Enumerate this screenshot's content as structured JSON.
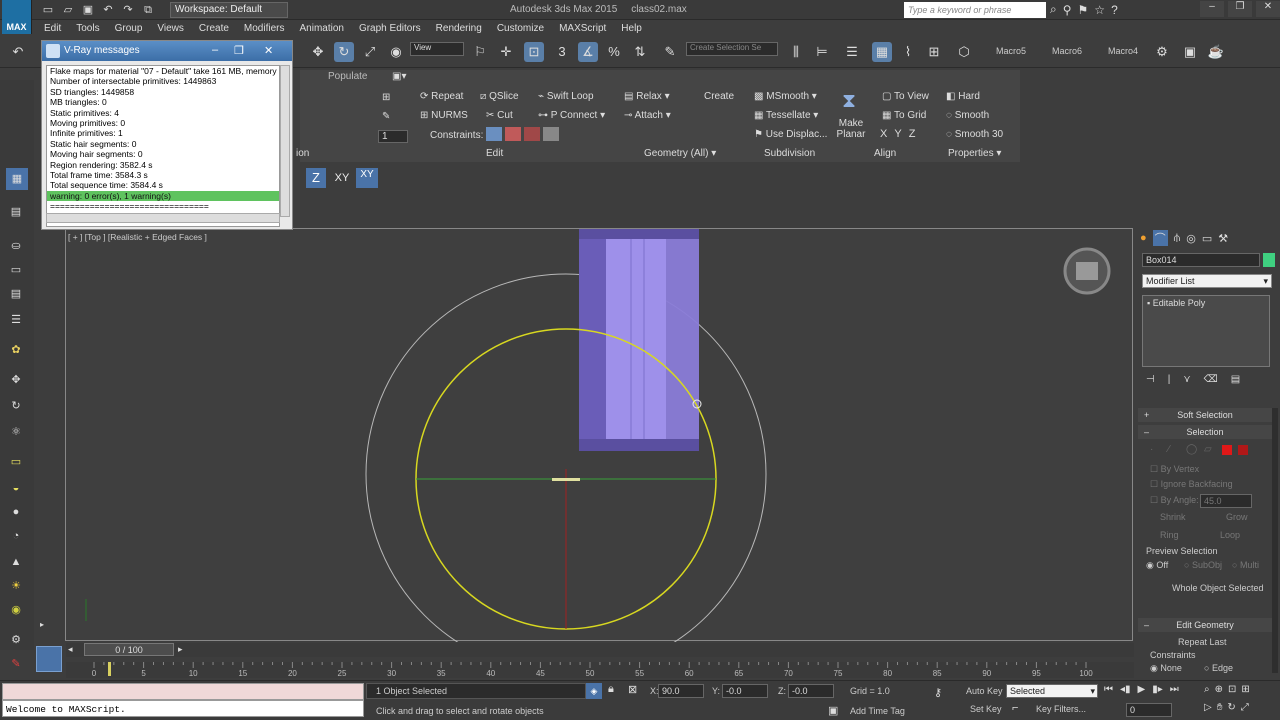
{
  "titlebar": {
    "logo": "MAX",
    "workspace": "Workspace: Default",
    "app_title": "Autodesk 3ds Max 2015",
    "file": "class02.max",
    "search_placeholder": "Type a keyword or phrase"
  },
  "menu": [
    "Edit",
    "Tools",
    "Group",
    "Views",
    "Create",
    "Modifiers",
    "Animation",
    "Graph Editors",
    "Rendering",
    "Customize",
    "MAXScript",
    "Help"
  ],
  "toolbar": {
    "view_dropdown": "View",
    "selection_set": "Create Selection Se",
    "macros": [
      "Macro5",
      "Macro6",
      "Macro4"
    ]
  },
  "ribbon": {
    "tab": "Populate",
    "row1": [
      "Repeat",
      "QSlice",
      "Swift Loop",
      "Relax",
      "Create",
      "MSmooth",
      "To View",
      "Hard"
    ],
    "row2": [
      "NURMS",
      "Cut",
      "P Connect",
      "Attach",
      "Tessellate",
      "To Grid",
      "Smooth"
    ],
    "row3": [
      "Constraints:",
      "Use Displac...",
      "Smooth 30"
    ],
    "make_planar": "Make Planar",
    "align_xyz": [
      "X",
      "Y",
      "Z"
    ],
    "spinner_value": "1",
    "headers": [
      "Edit",
      "Geometry (All)",
      "Subdivision",
      "Align",
      "Properties"
    ],
    "left_stub": "ion"
  },
  "axis_buttons": [
    "Z",
    "XY",
    "XY"
  ],
  "vray": {
    "title": "V-Ray messages",
    "lines": [
      "Flake maps for material \"07 - Default\" take 161 MB, memory",
      "Number of intersectable primitives: 1449863",
      "  SD triangles: 1449858",
      "  MB triangles: 0",
      "  Static primitives: 4",
      "  Moving primitives: 0",
      "  Infinite primitives: 1",
      "  Static hair segments: 0",
      "  Moving hair segments: 0",
      "Region rendering: 3582.4 s",
      "Total frame time: 3584.3 s",
      "Total sequence time: 3584.4 s"
    ],
    "warning": "warning: 0 error(s), 1 warning(s)",
    "divider": "================================"
  },
  "viewport": {
    "label": "[ + ] [Top ] [Realistic + Edged Faces ]"
  },
  "command_panel": {
    "object_name": "Box014",
    "object_color": "#3fd080",
    "modifier_list": "Modifier List",
    "stack_item": "Editable Poly",
    "soft_selection": "Soft Selection",
    "selection": "Selection",
    "by_vertex": "By Vertex",
    "ignore_backfacing": "Ignore Backfacing",
    "by_angle": "By Angle:",
    "by_angle_value": "45.0",
    "shrink": "Shrink",
    "grow": "Grow",
    "ring": "Ring",
    "loop": "Loop",
    "preview_selection": "Preview Selection",
    "preview_options": [
      "Off",
      "SubObj",
      "Multi"
    ],
    "whole_object": "Whole Object Selected",
    "edit_geometry": "Edit Geometry",
    "repeat_last": "Repeat Last",
    "constraints": "Constraints",
    "constraint_options": [
      "None",
      "Edge"
    ]
  },
  "timeline": {
    "frame": "0 / 100",
    "ticks": [
      "0",
      "5",
      "10",
      "15",
      "20",
      "25",
      "30",
      "35",
      "40",
      "45",
      "50",
      "55",
      "60",
      "65",
      "70",
      "75",
      "80",
      "85",
      "90",
      "95",
      "100"
    ]
  },
  "status": {
    "maxscript": "Welcome to MAXScript.",
    "selected": "1 Object Selected",
    "prompt": "Click and drag to select and rotate objects",
    "x_label": "X:",
    "x_value": "90.0",
    "y_label": "Y:",
    "y_value": "-0.0",
    "z_label": "Z:",
    "z_value": "-0.0",
    "grid": "Grid = 1.0",
    "add_time_tag": "Add Time Tag",
    "auto_key": "Auto Key",
    "set_key": "Set Key",
    "key_mode": "Selected",
    "key_filters": "Key Filters...",
    "frame_field": "0"
  }
}
